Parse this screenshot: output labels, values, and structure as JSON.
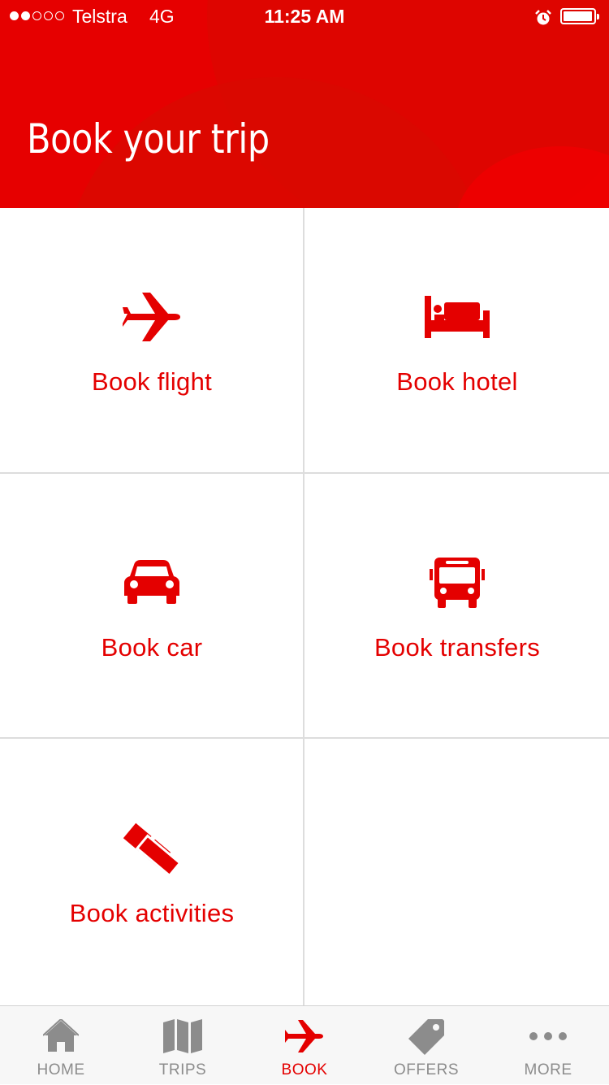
{
  "status_bar": {
    "carrier": "Telstra",
    "network": "4G",
    "time": "11:25 AM",
    "signal_bars_filled": 2,
    "signal_bars_total": 5
  },
  "header": {
    "title": "Book your trip"
  },
  "tiles": [
    {
      "label": "Book flight",
      "icon": "airplane-icon"
    },
    {
      "label": "Book hotel",
      "icon": "bed-icon"
    },
    {
      "label": "Book car",
      "icon": "car-icon"
    },
    {
      "label": "Book transfers",
      "icon": "bus-icon"
    },
    {
      "label": "Book activities",
      "icon": "tickets-icon"
    }
  ],
  "tab_bar": {
    "items": [
      {
        "label": "HOME",
        "icon": "home-icon"
      },
      {
        "label": "TRIPS",
        "icon": "map-icon"
      },
      {
        "label": "BOOK",
        "icon": "airplane-icon",
        "active": true
      },
      {
        "label": "OFFERS",
        "icon": "tag-icon"
      },
      {
        "label": "MORE",
        "icon": "more-icon"
      }
    ]
  },
  "colors": {
    "brand_red": "#e60000",
    "tile_text": "#e40000",
    "tab_inactive": "#8c8c8c"
  }
}
